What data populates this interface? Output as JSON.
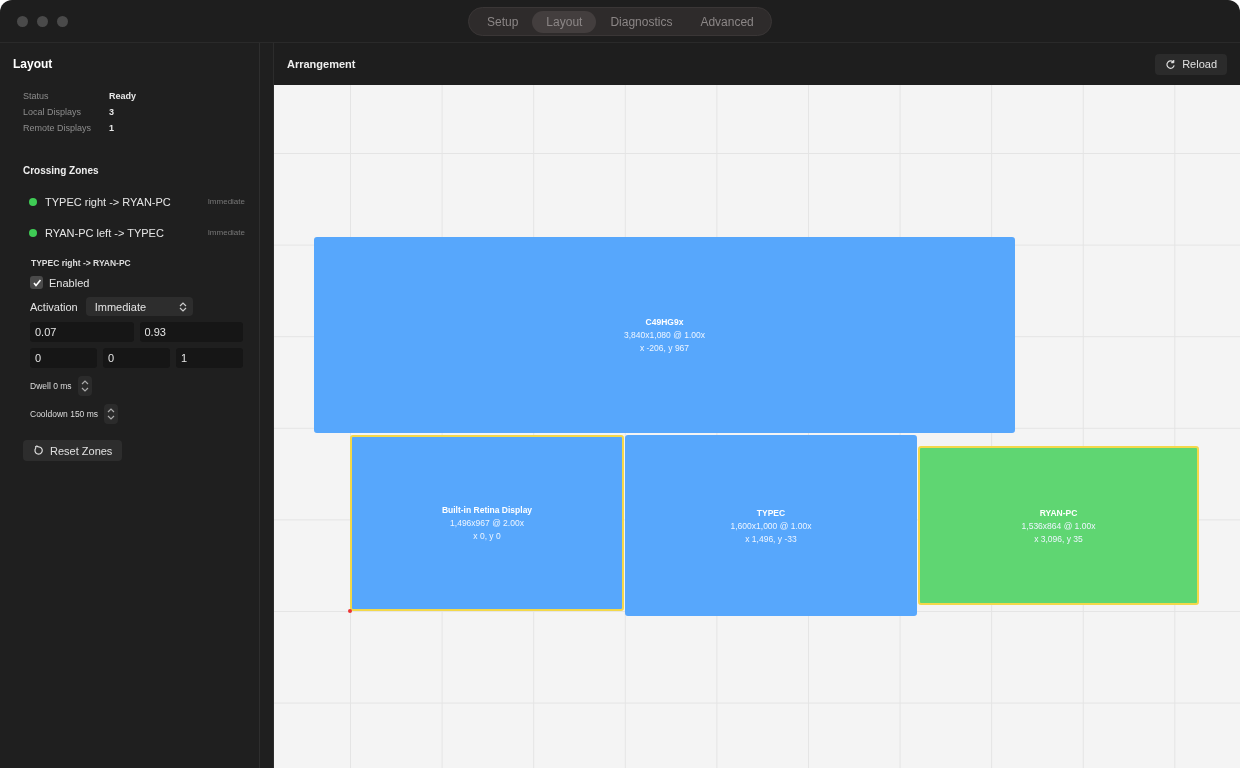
{
  "tabs": [
    {
      "label": "Setup",
      "selected": false
    },
    {
      "label": "Layout",
      "selected": true
    },
    {
      "label": "Diagnostics",
      "selected": false
    },
    {
      "label": "Advanced",
      "selected": false
    }
  ],
  "sidebar": {
    "title": "Layout",
    "stats": [
      {
        "label": "Status",
        "value": "Ready"
      },
      {
        "label": "Local Displays",
        "value": "3"
      },
      {
        "label": "Remote Displays",
        "value": "1"
      }
    ],
    "zones_title": "Crossing Zones",
    "zones": [
      {
        "name": "TYPEC right -> RYAN-PC",
        "mode": "Immediate",
        "color": "#3fcc55"
      },
      {
        "name": "RYAN-PC left -> TYPEC",
        "mode": "Immediate",
        "color": "#3fcc55"
      }
    ],
    "editor": {
      "title": "TYPEC right -> RYAN-PC",
      "enabled_label": "Enabled",
      "enabled": true,
      "activation_label": "Activation",
      "activation": "Immediate",
      "fields_row_1": [
        "0.07",
        "0.93"
      ],
      "fields_row_2": [
        "0",
        "0",
        "1"
      ],
      "steppers": [
        "Dwell 0 ms",
        "Cooldown 150 ms"
      ],
      "reset": "Reset Zones"
    }
  },
  "main": {
    "title": "Arrangement",
    "reload": "Reload",
    "displays": [
      {
        "name": "C49HG9x",
        "resolution": "3,840x1,080 @ 1.00x",
        "position": "x -206, y 967",
        "color": "#57a7fc",
        "highlighted": false
      },
      {
        "name": "Built-in Retina Display",
        "resolution": "1,496x967 @ 2.00x",
        "position": "x 0, y 0",
        "color": "#57a7fc",
        "highlighted": true
      },
      {
        "name": "TYPEC",
        "resolution": "1,600x1,000 @ 1.00x",
        "position": "x 1,496, y -33",
        "color": "#57a7fc",
        "highlighted": false
      },
      {
        "name": "RYAN-PC",
        "resolution": "1,536x864 @ 1.00x",
        "position": "x 3,096, y 35",
        "color": "#5fd672",
        "highlighted": true
      }
    ]
  }
}
